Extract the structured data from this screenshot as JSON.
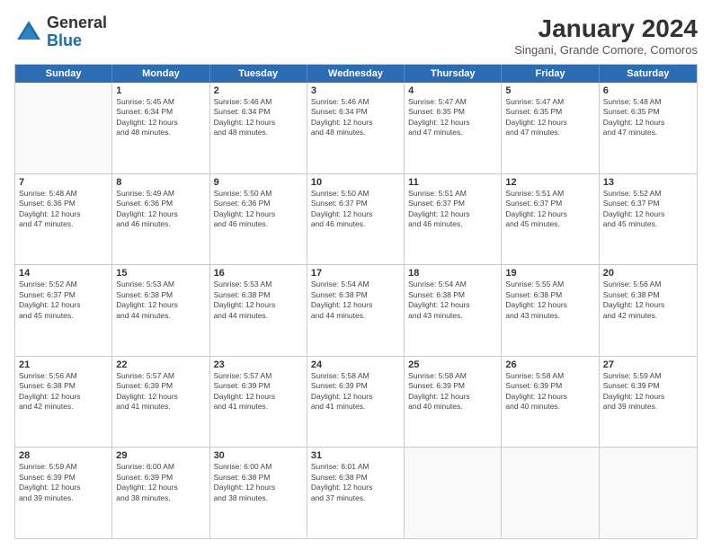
{
  "logo": {
    "line1": "General",
    "line2": "Blue"
  },
  "title": "January 2024",
  "subtitle": "Singani, Grande Comore, Comoros",
  "days_of_week": [
    "Sunday",
    "Monday",
    "Tuesday",
    "Wednesday",
    "Thursday",
    "Friday",
    "Saturday"
  ],
  "weeks": [
    [
      {
        "day": "",
        "empty": true
      },
      {
        "day": "1",
        "sunrise": "Sunrise: 5:45 AM",
        "sunset": "Sunset: 6:34 PM",
        "daylight": "Daylight: 12 hours",
        "minutes": "and 48 minutes."
      },
      {
        "day": "2",
        "sunrise": "Sunrise: 5:46 AM",
        "sunset": "Sunset: 6:34 PM",
        "daylight": "Daylight: 12 hours",
        "minutes": "and 48 minutes."
      },
      {
        "day": "3",
        "sunrise": "Sunrise: 5:46 AM",
        "sunset": "Sunset: 6:34 PM",
        "daylight": "Daylight: 12 hours",
        "minutes": "and 48 minutes."
      },
      {
        "day": "4",
        "sunrise": "Sunrise: 5:47 AM",
        "sunset": "Sunset: 6:35 PM",
        "daylight": "Daylight: 12 hours",
        "minutes": "and 47 minutes."
      },
      {
        "day": "5",
        "sunrise": "Sunrise: 5:47 AM",
        "sunset": "Sunset: 6:35 PM",
        "daylight": "Daylight: 12 hours",
        "minutes": "and 47 minutes."
      },
      {
        "day": "6",
        "sunrise": "Sunrise: 5:48 AM",
        "sunset": "Sunset: 6:35 PM",
        "daylight": "Daylight: 12 hours",
        "minutes": "and 47 minutes."
      }
    ],
    [
      {
        "day": "7",
        "sunrise": "Sunrise: 5:48 AM",
        "sunset": "Sunset: 6:36 PM",
        "daylight": "Daylight: 12 hours",
        "minutes": "and 47 minutes."
      },
      {
        "day": "8",
        "sunrise": "Sunrise: 5:49 AM",
        "sunset": "Sunset: 6:36 PM",
        "daylight": "Daylight: 12 hours",
        "minutes": "and 46 minutes."
      },
      {
        "day": "9",
        "sunrise": "Sunrise: 5:50 AM",
        "sunset": "Sunset: 6:36 PM",
        "daylight": "Daylight: 12 hours",
        "minutes": "and 46 minutes."
      },
      {
        "day": "10",
        "sunrise": "Sunrise: 5:50 AM",
        "sunset": "Sunset: 6:37 PM",
        "daylight": "Daylight: 12 hours",
        "minutes": "and 46 minutes."
      },
      {
        "day": "11",
        "sunrise": "Sunrise: 5:51 AM",
        "sunset": "Sunset: 6:37 PM",
        "daylight": "Daylight: 12 hours",
        "minutes": "and 46 minutes."
      },
      {
        "day": "12",
        "sunrise": "Sunrise: 5:51 AM",
        "sunset": "Sunset: 6:37 PM",
        "daylight": "Daylight: 12 hours",
        "minutes": "and 45 minutes."
      },
      {
        "day": "13",
        "sunrise": "Sunrise: 5:52 AM",
        "sunset": "Sunset: 6:37 PM",
        "daylight": "Daylight: 12 hours",
        "minutes": "and 45 minutes."
      }
    ],
    [
      {
        "day": "14",
        "sunrise": "Sunrise: 5:52 AM",
        "sunset": "Sunset: 6:37 PM",
        "daylight": "Daylight: 12 hours",
        "minutes": "and 45 minutes."
      },
      {
        "day": "15",
        "sunrise": "Sunrise: 5:53 AM",
        "sunset": "Sunset: 6:38 PM",
        "daylight": "Daylight: 12 hours",
        "minutes": "and 44 minutes."
      },
      {
        "day": "16",
        "sunrise": "Sunrise: 5:53 AM",
        "sunset": "Sunset: 6:38 PM",
        "daylight": "Daylight: 12 hours",
        "minutes": "and 44 minutes."
      },
      {
        "day": "17",
        "sunrise": "Sunrise: 5:54 AM",
        "sunset": "Sunset: 6:38 PM",
        "daylight": "Daylight: 12 hours",
        "minutes": "and 44 minutes."
      },
      {
        "day": "18",
        "sunrise": "Sunrise: 5:54 AM",
        "sunset": "Sunset: 6:38 PM",
        "daylight": "Daylight: 12 hours",
        "minutes": "and 43 minutes."
      },
      {
        "day": "19",
        "sunrise": "Sunrise: 5:55 AM",
        "sunset": "Sunset: 6:38 PM",
        "daylight": "Daylight: 12 hours",
        "minutes": "and 43 minutes."
      },
      {
        "day": "20",
        "sunrise": "Sunrise: 5:56 AM",
        "sunset": "Sunset: 6:38 PM",
        "daylight": "Daylight: 12 hours",
        "minutes": "and 42 minutes."
      }
    ],
    [
      {
        "day": "21",
        "sunrise": "Sunrise: 5:56 AM",
        "sunset": "Sunset: 6:38 PM",
        "daylight": "Daylight: 12 hours",
        "minutes": "and 42 minutes."
      },
      {
        "day": "22",
        "sunrise": "Sunrise: 5:57 AM",
        "sunset": "Sunset: 6:39 PM",
        "daylight": "Daylight: 12 hours",
        "minutes": "and 41 minutes."
      },
      {
        "day": "23",
        "sunrise": "Sunrise: 5:57 AM",
        "sunset": "Sunset: 6:39 PM",
        "daylight": "Daylight: 12 hours",
        "minutes": "and 41 minutes."
      },
      {
        "day": "24",
        "sunrise": "Sunrise: 5:58 AM",
        "sunset": "Sunset: 6:39 PM",
        "daylight": "Daylight: 12 hours",
        "minutes": "and 41 minutes."
      },
      {
        "day": "25",
        "sunrise": "Sunrise: 5:58 AM",
        "sunset": "Sunset: 6:39 PM",
        "daylight": "Daylight: 12 hours",
        "minutes": "and 40 minutes."
      },
      {
        "day": "26",
        "sunrise": "Sunrise: 5:58 AM",
        "sunset": "Sunset: 6:39 PM",
        "daylight": "Daylight: 12 hours",
        "minutes": "and 40 minutes."
      },
      {
        "day": "27",
        "sunrise": "Sunrise: 5:59 AM",
        "sunset": "Sunset: 6:39 PM",
        "daylight": "Daylight: 12 hours",
        "minutes": "and 39 minutes."
      }
    ],
    [
      {
        "day": "28",
        "sunrise": "Sunrise: 5:59 AM",
        "sunset": "Sunset: 6:39 PM",
        "daylight": "Daylight: 12 hours",
        "minutes": "and 39 minutes."
      },
      {
        "day": "29",
        "sunrise": "Sunrise: 6:00 AM",
        "sunset": "Sunset: 6:39 PM",
        "daylight": "Daylight: 12 hours",
        "minutes": "and 38 minutes."
      },
      {
        "day": "30",
        "sunrise": "Sunrise: 6:00 AM",
        "sunset": "Sunset: 6:38 PM",
        "daylight": "Daylight: 12 hours",
        "minutes": "and 38 minutes."
      },
      {
        "day": "31",
        "sunrise": "Sunrise: 6:01 AM",
        "sunset": "Sunset: 6:38 PM",
        "daylight": "Daylight: 12 hours",
        "minutes": "and 37 minutes."
      },
      {
        "day": "",
        "empty": true
      },
      {
        "day": "",
        "empty": true
      },
      {
        "day": "",
        "empty": true
      }
    ]
  ]
}
